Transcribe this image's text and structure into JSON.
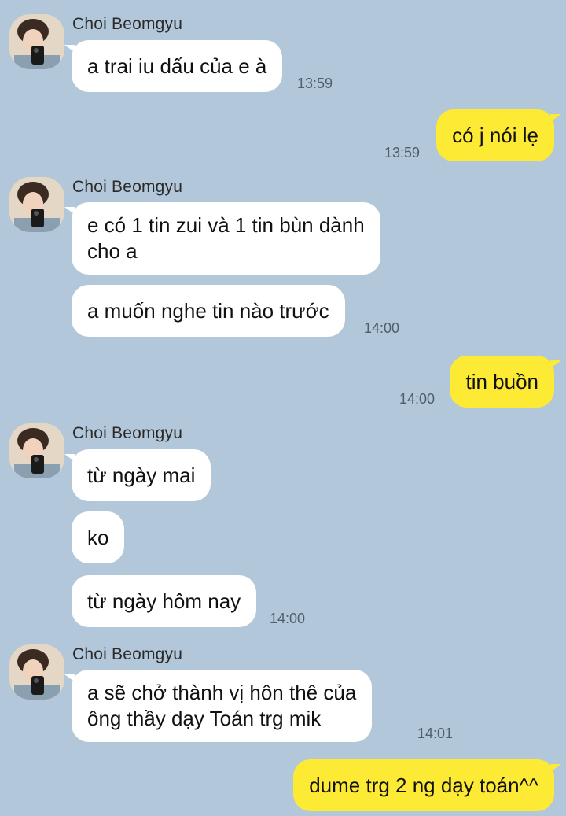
{
  "chat": {
    "contact_name": "Choi Beomgyu",
    "messages": [
      {
        "side": "in",
        "text": "a trai iu dấu của e à",
        "time": "13:59"
      },
      {
        "side": "out",
        "text": "có j nói lẹ",
        "time": "13:59"
      },
      {
        "side": "in",
        "text": "e có 1 tin zui và 1 tin bùn dành\ncho a",
        "time": ""
      },
      {
        "side": "in",
        "text": "a muốn nghe tin nào trước",
        "time": "14:00"
      },
      {
        "side": "out",
        "text": "tin buồn",
        "time": "14:00"
      },
      {
        "side": "in",
        "text": "từ ngày mai",
        "time": ""
      },
      {
        "side": "in",
        "text": "ko",
        "time": ""
      },
      {
        "side": "in",
        "text": "từ ngày hôm nay",
        "time": "14:00"
      },
      {
        "side": "in",
        "text": "a sẽ chở thành vị hôn thê của\nông thầy dạy Toán trg mik",
        "time": "14:01"
      },
      {
        "side": "out",
        "text": "dume trg 2 ng dạy toán^^",
        "time": ""
      }
    ]
  },
  "colors": {
    "background": "#b2c7da",
    "incoming_bubble": "#ffffff",
    "outgoing_bubble": "#fdea34"
  },
  "icons": {
    "avatar": "contact-profile-photo"
  }
}
